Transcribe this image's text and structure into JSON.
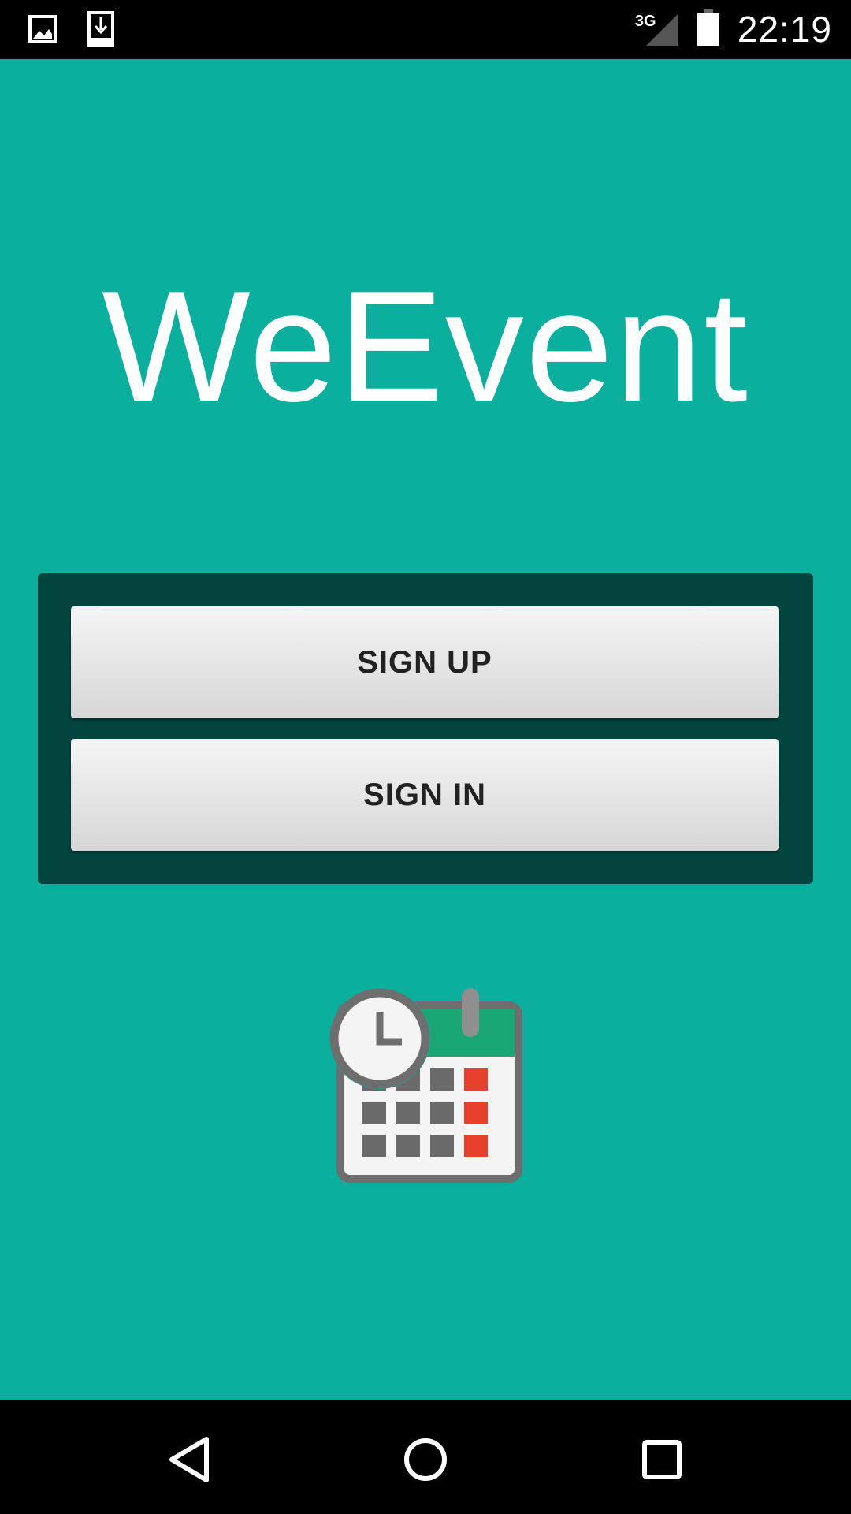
{
  "status_bar": {
    "left_icons": [
      "image-notification-icon",
      "download-notification-icon"
    ],
    "network_type": "3G",
    "time": "22:19"
  },
  "app": {
    "title": "WeEvent",
    "buttons": {
      "sign_up": "SIGN UP",
      "sign_in": "SIGN IN"
    },
    "logo_icon": "calendar-clock-icon"
  },
  "nav_bar": {
    "icons": [
      "back-icon",
      "home-icon",
      "recents-icon"
    ]
  },
  "colors": {
    "background": "#0aaf9e",
    "panel": "#02453f",
    "title_text": "#ffffff",
    "calendar_accent": "#e8412b"
  }
}
